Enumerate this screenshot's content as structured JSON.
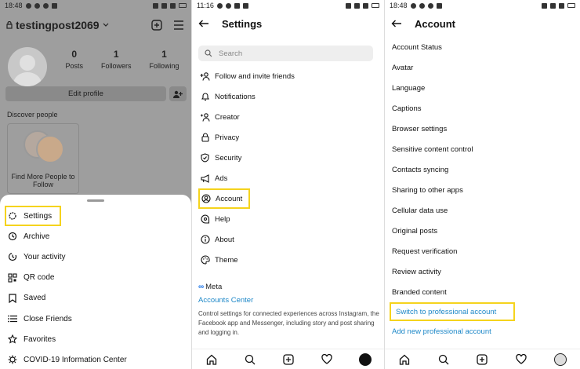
{
  "panel1": {
    "status_time": "18:48",
    "username": "testingpost2069",
    "stats": [
      {
        "num": "0",
        "label": "Posts"
      },
      {
        "num": "1",
        "label": "Followers"
      },
      {
        "num": "1",
        "label": "Following"
      }
    ],
    "edit_profile": "Edit profile",
    "discover_title": "Discover people",
    "card_text": "Find More People to Follow",
    "menu": [
      {
        "label": "Settings",
        "icon": "gear-icon"
      },
      {
        "label": "Archive",
        "icon": "archive-icon"
      },
      {
        "label": "Your activity",
        "icon": "activity-icon"
      },
      {
        "label": "QR code",
        "icon": "qr-icon"
      },
      {
        "label": "Saved",
        "icon": "bookmark-icon"
      },
      {
        "label": "Close Friends",
        "icon": "list-icon"
      },
      {
        "label": "Favorites",
        "icon": "star-icon"
      },
      {
        "label": "COVID-19 Information Center",
        "icon": "covid-icon"
      }
    ]
  },
  "panel2": {
    "status_time": "11:16",
    "title": "Settings",
    "search_placeholder": "Search",
    "items": [
      {
        "label": "Follow and invite friends",
        "icon": "add-person-icon"
      },
      {
        "label": "Notifications",
        "icon": "bell-icon"
      },
      {
        "label": "Creator",
        "icon": "creator-icon"
      },
      {
        "label": "Privacy",
        "icon": "lock-icon"
      },
      {
        "label": "Security",
        "icon": "shield-icon"
      },
      {
        "label": "Ads",
        "icon": "megaphone-icon"
      },
      {
        "label": "Account",
        "icon": "account-icon"
      },
      {
        "label": "Help",
        "icon": "help-icon"
      },
      {
        "label": "About",
        "icon": "info-icon"
      },
      {
        "label": "Theme",
        "icon": "palette-icon"
      }
    ],
    "meta_label": "Meta",
    "accounts_center": "Accounts Center",
    "accounts_center_desc": "Control settings for connected experiences across Instagram, the Facebook app and Messenger, including story and post sharing and logging in."
  },
  "panel3": {
    "status_time": "18:48",
    "title": "Account",
    "items": [
      "Account Status",
      "Avatar",
      "Language",
      "Captions",
      "Browser settings",
      "Sensitive content control",
      "Contacts syncing",
      "Sharing to other apps",
      "Cellular data use",
      "Original posts",
      "Request verification",
      "Review activity",
      "Branded content",
      "Switch to professional account",
      "Add new professional account"
    ]
  },
  "colors": {
    "highlight": "#f5d31d",
    "link_blue": "#1e88c8"
  }
}
